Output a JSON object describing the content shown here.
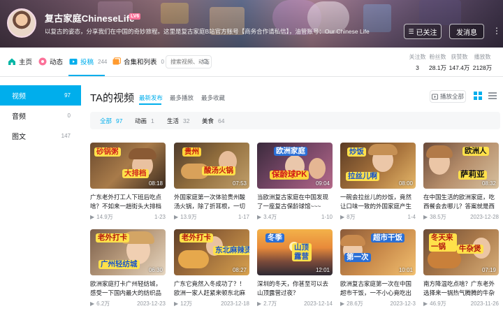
{
  "header": {
    "username": "复古家庭ChineseLife",
    "level_badge": "LV6",
    "signature": "以复古的姿态，分享我们在中国的奇妙旅程。这里是复古家庭B站官方账号【商务合作请私信】，油管账号：Our Chinese Life",
    "follow_label": "已关注",
    "message_label": "发消息",
    "more_glyph": "⋮"
  },
  "nav": {
    "home": "主页",
    "dynamic": "动态",
    "posts": "投稿",
    "posts_count": "244",
    "collections": "合集和列表",
    "collections_count": "0",
    "search_placeholder": "搜索视频、动态"
  },
  "stats": [
    {
      "label": "关注数",
      "value": "3"
    },
    {
      "label": "粉丝数",
      "value": "28.1万"
    },
    {
      "label": "获赞数",
      "value": "147.4万"
    },
    {
      "label": "播放数",
      "value": "2128万"
    }
  ],
  "sidebar": {
    "items": [
      {
        "label": "视频",
        "count": "97"
      },
      {
        "label": "音频",
        "count": "0"
      },
      {
        "label": "图文",
        "count": "147"
      }
    ]
  },
  "main": {
    "title": "TA的视频",
    "sort": [
      "最新发布",
      "最多播放",
      "最多收藏"
    ],
    "play_all": "播放全部",
    "filters": [
      {
        "label": "全部",
        "count": "97"
      },
      {
        "label": "动画",
        "count": "1"
      },
      {
        "label": "生活",
        "count": "32"
      },
      {
        "label": "美食",
        "count": "64"
      }
    ]
  },
  "videos": [
    {
      "title": "广东老外打工人下班后吃点啥？不如来一趟街头大排档砂",
      "duration": "08:18",
      "plays": "14.9万",
      "date": "1-23",
      "captions": [
        "砂锅粥",
        "大排档"
      ]
    },
    {
      "title": "外国家庭第一次体验贵州酸汤火锅，除了折耳根，一切都很",
      "duration": "07:53",
      "plays": "13.9万",
      "date": "1-17",
      "captions": [
        "贵州",
        "酸汤火锅"
      ]
    },
    {
      "title": "当欧洲复古家庭在中国发现了一座复古保龄球馆~~~",
      "duration": "09:04",
      "plays": "3.4万",
      "date": "1-10",
      "captions": [
        "欧洲家庭",
        "保龄球PK"
      ]
    },
    {
      "title": "一碗会拉丝儿的炒饭，竟然让口味一致的外国家庭产生了分",
      "duration": "08:00",
      "plays": "8万",
      "date": "1-4",
      "captions": [
        "炒饭",
        "拉丝儿啊"
      ]
    },
    {
      "title": "在中国生活的欧洲家庭，吃西餐会去哪儿？答案就是西餐厅",
      "duration": "08:32",
      "plays": "38.5万",
      "date": "2023-12-28",
      "captions": [
        "欧洲人",
        "萨莉亚"
      ]
    },
    {
      "title": "欧洲家庭打卡广州轻纺城，感受一下国内最大的纺织品批发",
      "duration": "06:30",
      "plays": "6.2万",
      "date": "2023-12-23",
      "captions": [
        "老外打卡",
        "广州轻纺城"
      ]
    },
    {
      "title": "广东它竟然入冬成功了？！欧洲一家人赶紧来顿东北麻辣烫",
      "duration": "08:27",
      "plays": "12万",
      "date": "2023-12-18",
      "captions": [
        "老外打卡",
        "东北麻辣烫"
      ]
    },
    {
      "title": "深圳的冬天，你甚至可以去山顶露营过夜？",
      "duration": "12:01",
      "plays": "2.7万",
      "date": "2023-12-14",
      "captions": [
        "冬季",
        "山顶露营"
      ]
    },
    {
      "title": "欧洲复古家庭第一次在中国超市干饭，一不小心竟吃出了游乐场",
      "duration": "10:01",
      "plays": "28.6万",
      "date": "2023-12-3",
      "captions": [
        "第一次",
        "超市干饭"
      ]
    },
    {
      "title": "南方降温吃点啥？广东老外选择来一锅热气腾腾的牛杂煲！",
      "duration": "07:19",
      "plays": "46.9万",
      "date": "2023-11-26",
      "captions": [
        "冬天来一锅",
        "牛杂煲"
      ]
    }
  ],
  "colors": {
    "accent": "#00aeec",
    "pink": "#fb7299",
    "text": "#18191c",
    "muted": "#9499a0"
  }
}
